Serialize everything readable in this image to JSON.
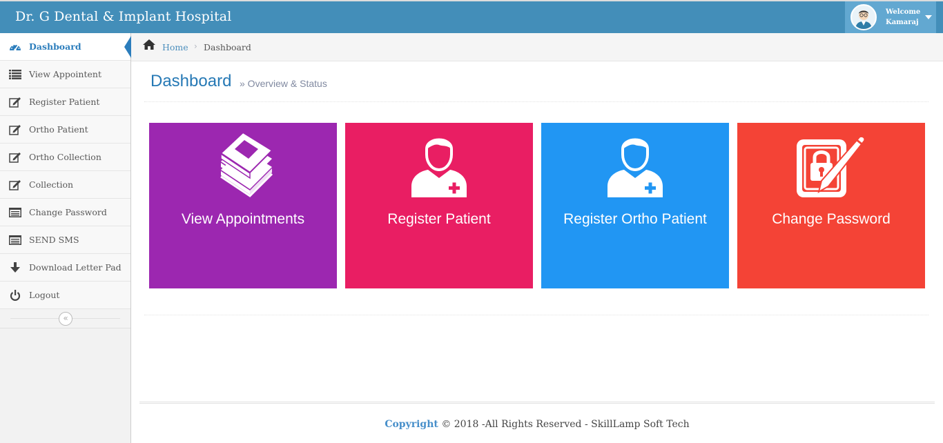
{
  "app": {
    "title": "Dr. G Dental & Implant Hospital",
    "user": {
      "welcome": "Welcome",
      "name": "Kamaraj"
    }
  },
  "sidebar": {
    "items": [
      {
        "label": "Dashboard",
        "icon": "tachometer-icon",
        "active": true
      },
      {
        "label": "View Appointent",
        "icon": "list-icon"
      },
      {
        "label": "Register Patient",
        "icon": "edit-icon"
      },
      {
        "label": "Ortho Patient",
        "icon": "edit-icon"
      },
      {
        "label": "Ortho Collection",
        "icon": "edit-icon"
      },
      {
        "label": "Collection",
        "icon": "edit-icon"
      },
      {
        "label": "Change Password",
        "icon": "list-alt-icon"
      },
      {
        "label": "SEND SMS",
        "icon": "list-alt-icon"
      },
      {
        "label": "Download Letter Pad",
        "icon": "arrow-down-icon"
      },
      {
        "label": "Logout",
        "icon": "power-icon"
      }
    ],
    "collapse_icon": "double-angle-left-icon"
  },
  "breadcrumb": {
    "home": "Home",
    "current": "Dashboard"
  },
  "page": {
    "title": "Dashboard",
    "subtitle": "» Overview & Status"
  },
  "tiles": [
    {
      "label": "View Appointments",
      "color": "#9c27b0",
      "icon": "book-stack-icon"
    },
    {
      "label": "Register Patient",
      "color": "#e91e63",
      "icon": "patient-icon"
    },
    {
      "label": "Register Ortho Patient",
      "color": "#2196f3",
      "icon": "patient-icon"
    },
    {
      "label": "Change Password",
      "color": "#f44336",
      "icon": "lock-edit-icon"
    }
  ],
  "footer": {
    "brand": "Copyright",
    "text": " © 2018 -All Rights Reserved - SkillLamp Soft Tech"
  }
}
